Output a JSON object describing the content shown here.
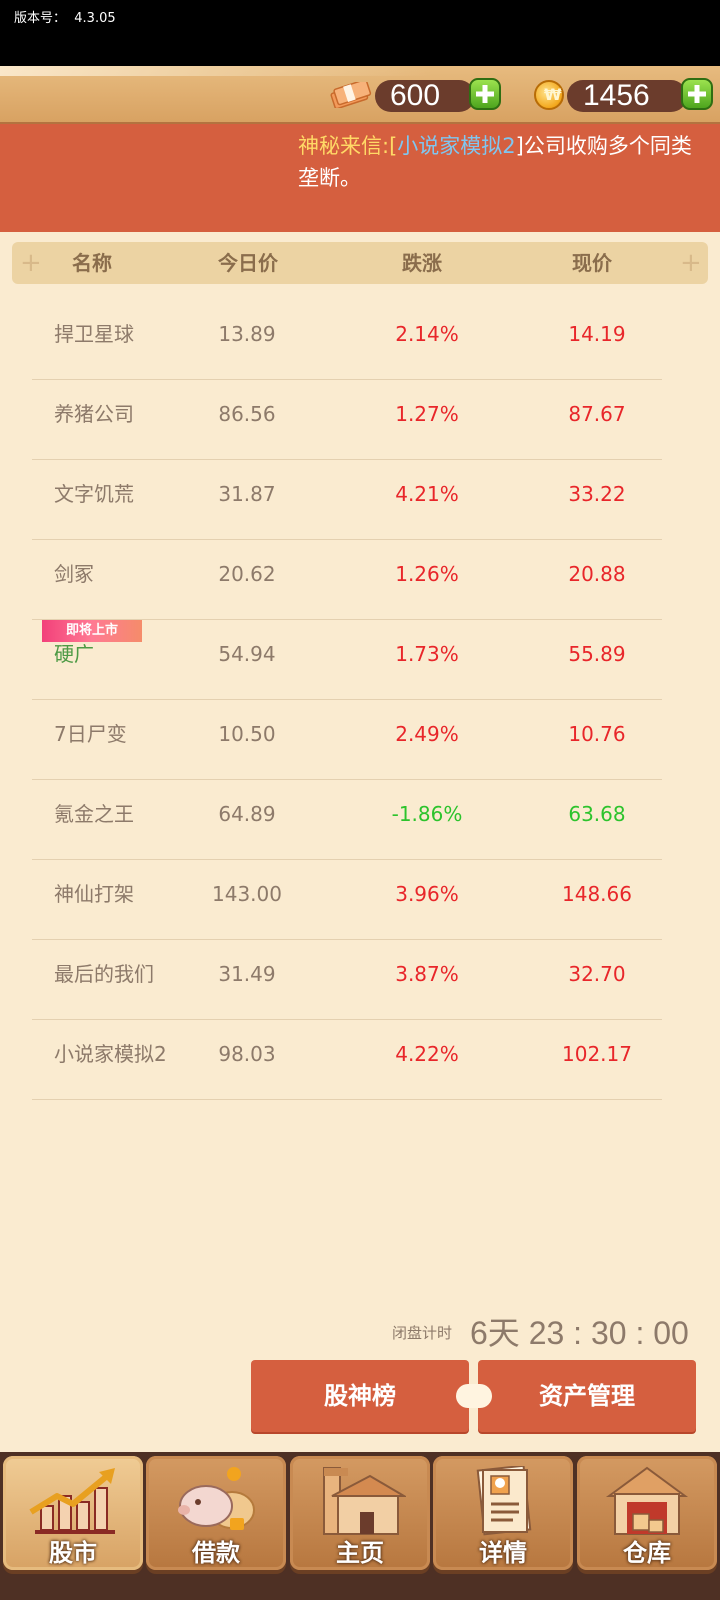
{
  "status": {
    "version_label": "版本号：",
    "version": "4.3.05"
  },
  "resources": {
    "cash": "600",
    "coins": "1456",
    "coin_glyph": "₩"
  },
  "news": {
    "prefix": "神秘来信:[",
    "company": "小说家模拟2",
    "suffix": "]公司收购多个同类",
    "line2": "垄断。"
  },
  "table": {
    "headers": {
      "name": "名称",
      "today": "今日价",
      "change": "跌涨",
      "current": "现价"
    },
    "rows": [
      {
        "name": "捍卫星球",
        "today": "13.89",
        "change": "2.14%",
        "current": "14.19",
        "trend": "up"
      },
      {
        "name": "养猪公司",
        "today": "86.56",
        "change": "1.27%",
        "current": "87.67",
        "trend": "up"
      },
      {
        "name": "文字饥荒",
        "today": "31.87",
        "change": "4.21%",
        "current": "33.22",
        "trend": "up"
      },
      {
        "name": "剑冢",
        "today": "20.62",
        "change": "1.26%",
        "current": "20.88",
        "trend": "up"
      },
      {
        "name": "硬广",
        "today": "54.94",
        "change": "1.73%",
        "current": "55.89",
        "trend": "up",
        "badge": "即将上市"
      },
      {
        "name": "7日尸变",
        "today": "10.50",
        "change": "2.49%",
        "current": "10.76",
        "trend": "up"
      },
      {
        "name": "氪金之王",
        "today": "64.89",
        "change": "-1.86%",
        "current": "63.68",
        "trend": "down"
      },
      {
        "name": "神仙打架",
        "today": "143.00",
        "change": "3.96%",
        "current": "148.66",
        "trend": "up"
      },
      {
        "name": "最后的我们",
        "today": "31.49",
        "change": "3.87%",
        "current": "32.70",
        "trend": "up"
      },
      {
        "name": "小说家模拟2",
        "today": "98.03",
        "change": "4.22%",
        "current": "102.17",
        "trend": "up"
      }
    ]
  },
  "countdown": {
    "label": "闭盘计时",
    "value": "6天 23 : 30 : 00"
  },
  "actions": {
    "leaderboard": "股神榜",
    "assets": "资产管理"
  },
  "tabs": [
    {
      "label": "股市",
      "icon": "chart-icon"
    },
    {
      "label": "借款",
      "icon": "piggy-bank-icon"
    },
    {
      "label": "主页",
      "icon": "house-icon"
    },
    {
      "label": "详情",
      "icon": "profile-doc-icon"
    },
    {
      "label": "仓库",
      "icon": "warehouse-icon"
    }
  ],
  "colors": {
    "up": "#e8262a",
    "down": "#2cc32c",
    "accent": "#d55f3f",
    "background": "#faebd0"
  }
}
